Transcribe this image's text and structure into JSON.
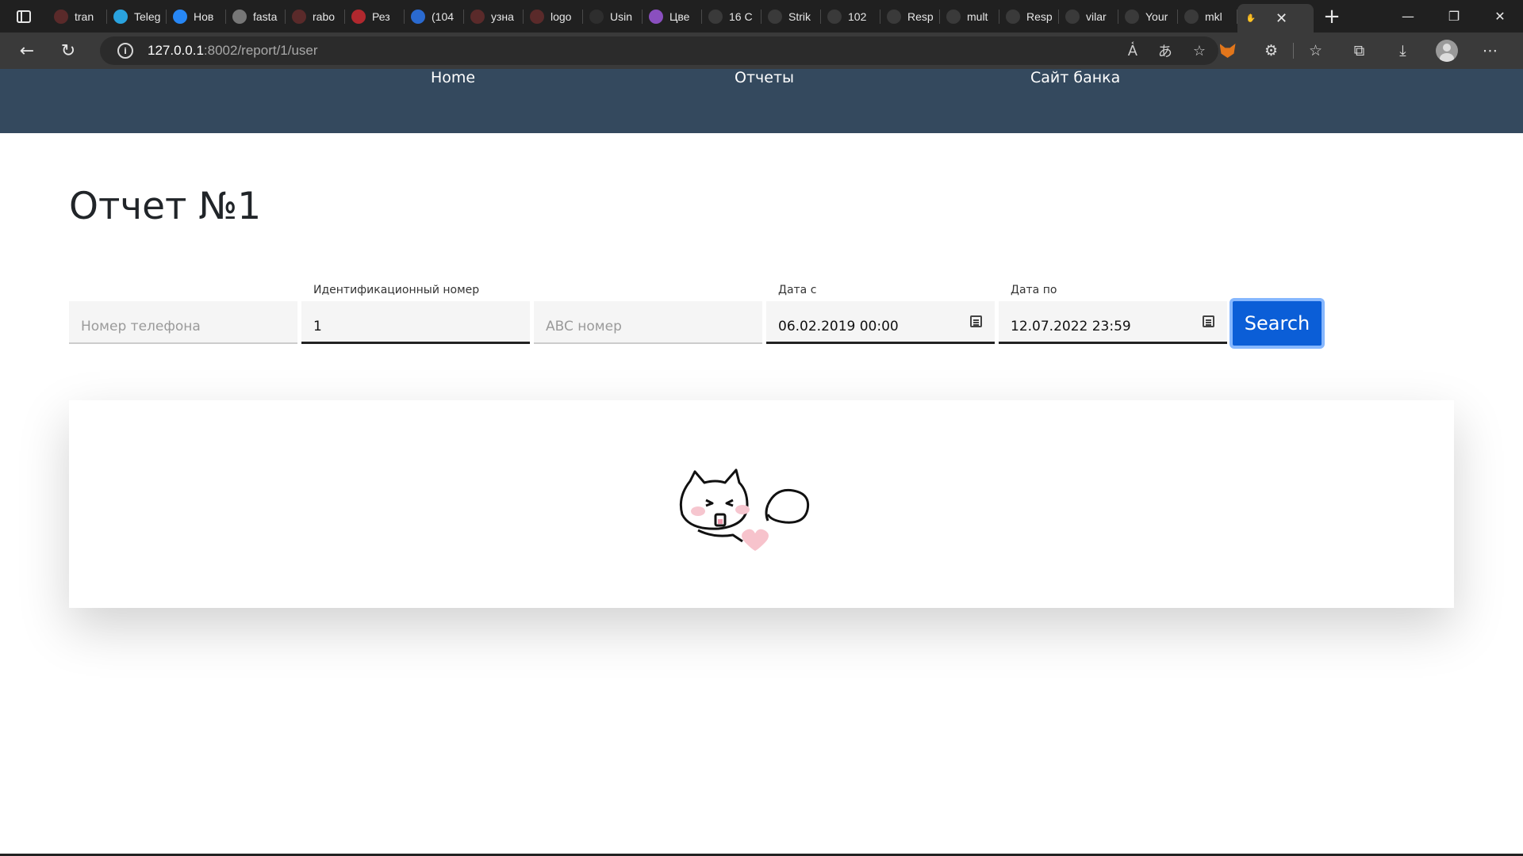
{
  "browser": {
    "tabs": [
      {
        "title": "tran",
        "icon": "yandex-icon",
        "color": "#5a2a2a"
      },
      {
        "title": "Teleg",
        "icon": "telegram-icon",
        "color": "#2aa3df"
      },
      {
        "title": "Нов",
        "icon": "vk-icon",
        "color": "#2787f5"
      },
      {
        "title": "fasta",
        "icon": "generic-site-icon",
        "color": "#777777"
      },
      {
        "title": "rabo",
        "icon": "yandex-icon",
        "color": "#5a2a2a"
      },
      {
        "title": "Рез",
        "icon": "r-icon",
        "color": "#b1282e"
      },
      {
        "title": "(104",
        "icon": "mail-icon",
        "color": "#2a6ad0"
      },
      {
        "title": "узна",
        "icon": "yandex-icon",
        "color": "#5a2a2a"
      },
      {
        "title": "logo",
        "icon": "yandex-icon",
        "color": "#5a2a2a"
      },
      {
        "title": "Usin",
        "icon": "django-icon",
        "color": "#2e2e2e"
      },
      {
        "title": "Цве",
        "icon": "color-wheel-icon",
        "color": "#8a4fbf"
      },
      {
        "title": "16 С",
        "icon": "f-icon",
        "color": "#3a3a3a"
      },
      {
        "title": "Strik",
        "icon": "openai-icon",
        "color": "#3a3a3a"
      },
      {
        "title": "102",
        "icon": "f-icon",
        "color": "#3a3a3a"
      },
      {
        "title": "Resp",
        "icon": "openai-icon",
        "color": "#3a3a3a"
      },
      {
        "title": "mult",
        "icon": "openai-icon",
        "color": "#3a3a3a"
      },
      {
        "title": "Resp",
        "icon": "openai-icon",
        "color": "#3a3a3a"
      },
      {
        "title": "vilar",
        "icon": "github-icon",
        "color": "#3a3a3a"
      },
      {
        "title": "Your",
        "icon": "github-icon",
        "color": "#3a3a3a"
      },
      {
        "title": "mkl",
        "icon": "github-icon",
        "color": "#3a3a3a"
      }
    ],
    "url_host": "127.0.0.1",
    "url_rest": ":8002/report/1/user"
  },
  "nav": {
    "home": "Home",
    "reports": "Отчеты",
    "bank_site": "Сайт банка"
  },
  "page": {
    "title": "Отчет №1"
  },
  "form": {
    "phone_placeholder": "Номер телефона",
    "id_label": "Идентификационный номер",
    "id_value": "1",
    "abc_placeholder": "ABC номер",
    "date_from_label": "Дата с",
    "date_from_value": "06.02.2019 00:00",
    "date_to_label": "Дата по",
    "date_to_value": "12.07.2022 23:59",
    "search_label": "Search"
  },
  "colors": {
    "nav_bg": "#34495e",
    "button": "#0b5ed7",
    "button_focus": "#86b7fe"
  }
}
